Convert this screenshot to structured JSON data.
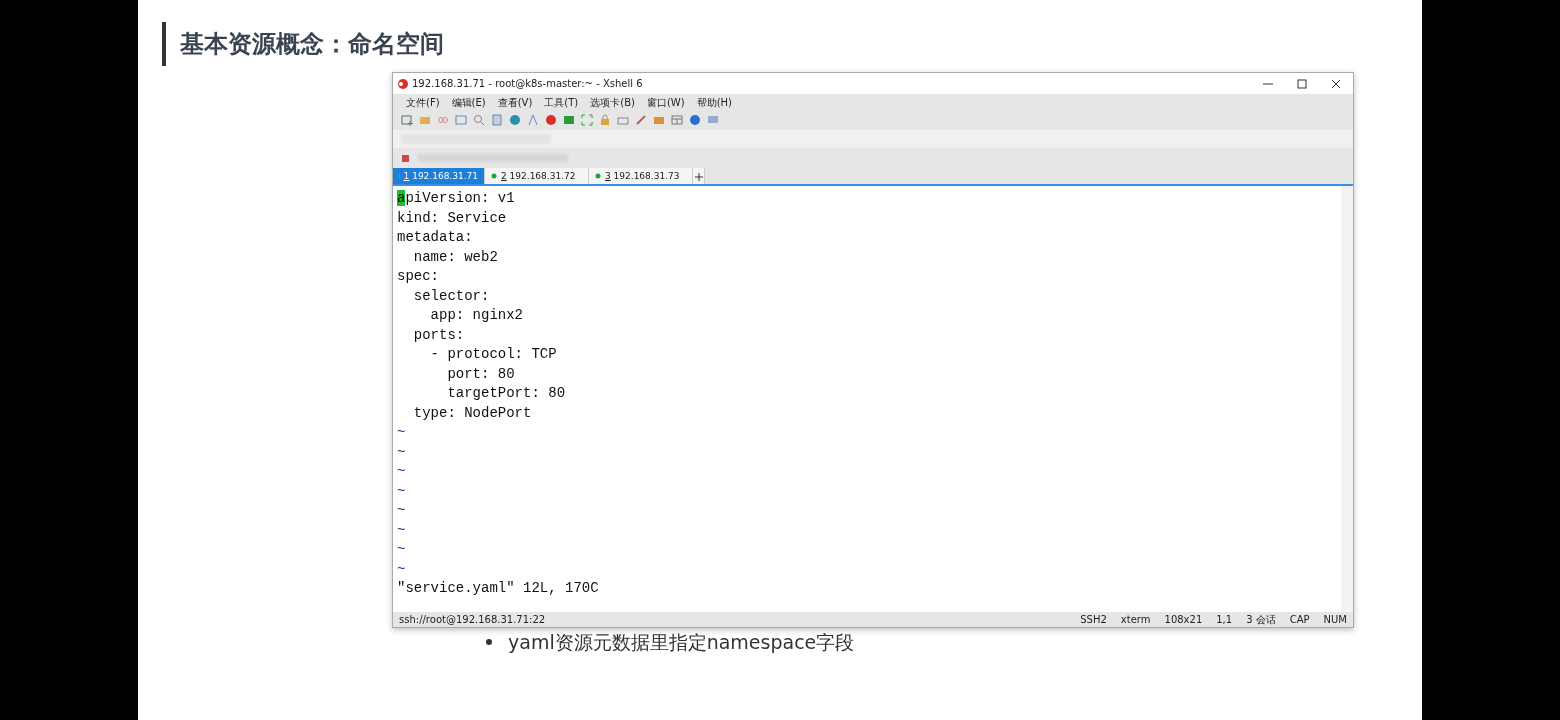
{
  "slide": {
    "title": "基本资源概念：命名空间",
    "bullet": "yaml资源元数据里指定namespace字段"
  },
  "window": {
    "title": "192.168.31.71 - root@k8s-master:~ - Xshell 6",
    "menu": [
      "文件(F)",
      "编辑(E)",
      "查看(V)",
      "工具(T)",
      "选项卡(B)",
      "窗口(W)",
      "帮助(H)"
    ],
    "tabs": [
      {
        "number": "1",
        "label": "192.168.31.71",
        "selected": true
      },
      {
        "number": "2",
        "label": "192.168.31.72",
        "selected": false
      },
      {
        "number": "3",
        "label": "192.168.31.73",
        "selected": false
      }
    ],
    "terminal": {
      "lines": [
        {
          "text": "apiVersion: v1",
          "cursor": true
        },
        {
          "text": "kind: Service",
          "cursor": false
        },
        {
          "text": "metadata:",
          "cursor": false
        },
        {
          "text": "  name: web2",
          "cursor": false
        },
        {
          "text": "spec:",
          "cursor": false
        },
        {
          "text": "  selector:",
          "cursor": false
        },
        {
          "text": "    app: nginx2",
          "cursor": false
        },
        {
          "text": "  ports:",
          "cursor": false
        },
        {
          "text": "    - protocol: TCP",
          "cursor": false
        },
        {
          "text": "      port: 80",
          "cursor": false
        },
        {
          "text": "      targetPort: 80",
          "cursor": false
        },
        {
          "text": "  type: NodePort",
          "cursor": false
        },
        {
          "text": "~",
          "cursor": false
        },
        {
          "text": "~",
          "cursor": false
        },
        {
          "text": "~",
          "cursor": false
        },
        {
          "text": "~",
          "cursor": false
        },
        {
          "text": "~",
          "cursor": false
        },
        {
          "text": "~",
          "cursor": false
        },
        {
          "text": "~",
          "cursor": false
        },
        {
          "text": "~",
          "cursor": false
        },
        {
          "text": "\"service.yaml\" 12L, 170C",
          "cursor": false
        }
      ]
    },
    "status_bar": {
      "address": "ssh://root@192.168.31.71:22",
      "items": [
        "SSH2",
        "xterm",
        "108x21",
        "1,1",
        "3 会话",
        "CAP",
        "NUM"
      ]
    }
  }
}
